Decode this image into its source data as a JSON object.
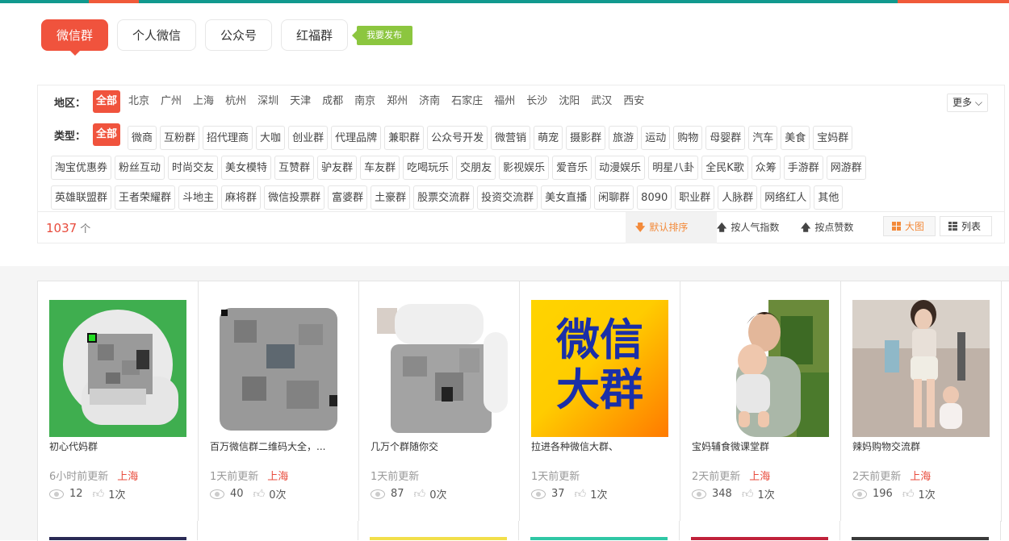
{
  "tabs": [
    {
      "label": "微信群",
      "active": true
    },
    {
      "label": "个人微信",
      "active": false
    },
    {
      "label": "公众号",
      "active": false
    },
    {
      "label": "红福群",
      "active": false
    }
  ],
  "publish_label": "我要发布",
  "region": {
    "label": "地区：",
    "all": "全部",
    "items": [
      "北京",
      "广州",
      "上海",
      "杭州",
      "深圳",
      "天津",
      "成都",
      "南京",
      "郑州",
      "济南",
      "石家庄",
      "福州",
      "长沙",
      "沈阳",
      "武汉",
      "西安"
    ],
    "more": "更多"
  },
  "type": {
    "label": "类型：",
    "all": "全部",
    "lines": [
      [
        "微商",
        "互粉群",
        "招代理商",
        "大咖",
        "创业群",
        "代理品牌",
        "兼职群",
        "公众号开发",
        "微营销",
        "萌宠",
        "摄影群",
        "旅游",
        "运动",
        "购物",
        "母婴群",
        "汽车",
        "美食",
        "宝妈群"
      ],
      [
        "淘宝优惠券",
        "粉丝互动",
        "时尚交友",
        "美女模特",
        "互赞群",
        "驴友群",
        "车友群",
        "吃喝玩乐",
        "交朋友",
        "影视娱乐",
        "爱音乐",
        "动漫娱乐",
        "明星八卦",
        "全民K歌",
        "众筹",
        "手游群",
        "网游群"
      ],
      [
        "英雄联盟群",
        "王者荣耀群",
        "斗地主",
        "麻将群",
        "微信投票群",
        "富婆群",
        "土豪群",
        "股票交流群",
        "投资交流群",
        "美女直播",
        "闲聊群",
        "8090",
        "职业群",
        "人脉群",
        "网络红人",
        "其他"
      ]
    ]
  },
  "result": {
    "count": "1037",
    "unit": "个"
  },
  "sort": {
    "default": "默认排序",
    "popular": "按人气指数",
    "likes": "按点赞数"
  },
  "view": {
    "grid": "大图",
    "list": "列表"
  },
  "colors": {
    "accent": "#f0533d",
    "green": "#8cc63f",
    "teal": "#11998e",
    "orange": "#f38a3a"
  },
  "cards": [
    {
      "name": "初心代妈群",
      "updated": "6小时前更新",
      "location": "上海",
      "views": "12",
      "likes": "1次"
    },
    {
      "name": "百万微信群二维码大全，...",
      "updated": "1天前更新",
      "location": "上海",
      "views": "40",
      "likes": "0次"
    },
    {
      "name": "几万个群随你交",
      "updated": "1天前更新",
      "location": "",
      "views": "87",
      "likes": "0次"
    },
    {
      "name": "拉进各种微信大群、",
      "updated": "1天前更新",
      "location": "",
      "views": "37",
      "likes": "1次",
      "poster_line1": "微信",
      "poster_line2": "大群"
    },
    {
      "name": "宝妈辅食微课堂群",
      "updated": "2天前更新",
      "location": "上海",
      "views": "348",
      "likes": "1次"
    },
    {
      "name": "辣妈购物交流群",
      "updated": "2天前更新",
      "location": "上海",
      "views": "196",
      "likes": "1次"
    }
  ]
}
